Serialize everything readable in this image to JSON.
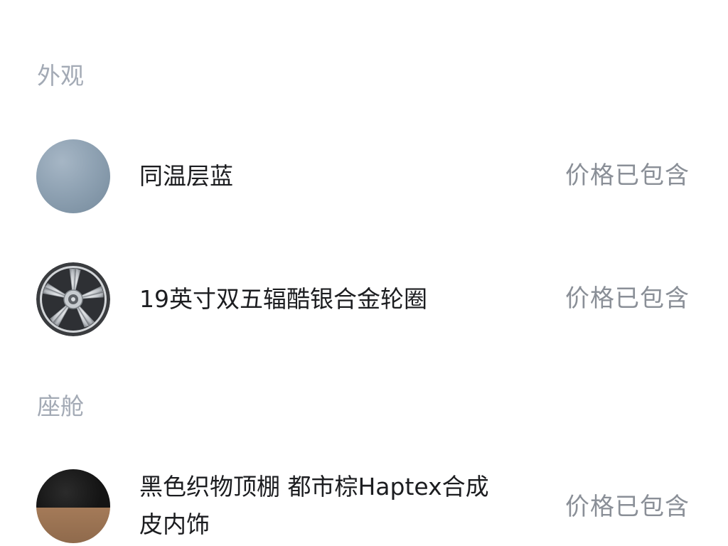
{
  "sections": [
    {
      "title": "外观",
      "items": [
        {
          "name": "同温层蓝",
          "price_note": "价格已包含",
          "swatch_icon": "stratosphere-blue-color-swatch",
          "swatch_color": "#8fa2b3"
        },
        {
          "name": "19英寸双五辐酷银合金轮圈",
          "price_note": "价格已包含",
          "swatch_icon": "alloy-wheel-icon"
        }
      ]
    },
    {
      "title": "座舱",
      "items": [
        {
          "name_line1": "黑色织物顶棚 都市棕Haptex合成",
          "name_line2": "皮内饰",
          "price_note": "价格已包含",
          "swatch_icon": "interior-color-swatch",
          "swatch_colors": [
            "#141414",
            "#9a7253"
          ]
        }
      ]
    }
  ]
}
